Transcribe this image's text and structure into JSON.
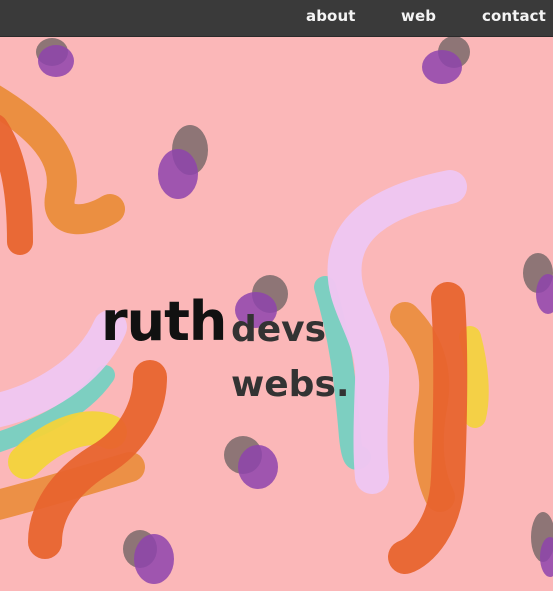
{
  "nav": {
    "items": [
      {
        "label": "about"
      },
      {
        "label": "web"
      },
      {
        "label": "contact"
      }
    ]
  },
  "hero": {
    "name": "ruth",
    "tagline_line1": "devs",
    "tagline_line2": "webs."
  },
  "colors": {
    "background": "#fbb7b8",
    "topbar": "#3a3a3a",
    "nav_text": "#f4f4f4",
    "name_text": "#111111",
    "tagline_text": "#333333",
    "stroke_orange": "#e8642e",
    "stroke_amber": "#ea8c3a",
    "stroke_yellow": "#f3d33a",
    "stroke_lavender": "#efc6f1",
    "stroke_teal": "#6fd1c2",
    "dab_purple": "#8e44ad",
    "dab_gray": "#7a6a6a"
  },
  "decor": {
    "icon": "paint-strokes-background"
  }
}
